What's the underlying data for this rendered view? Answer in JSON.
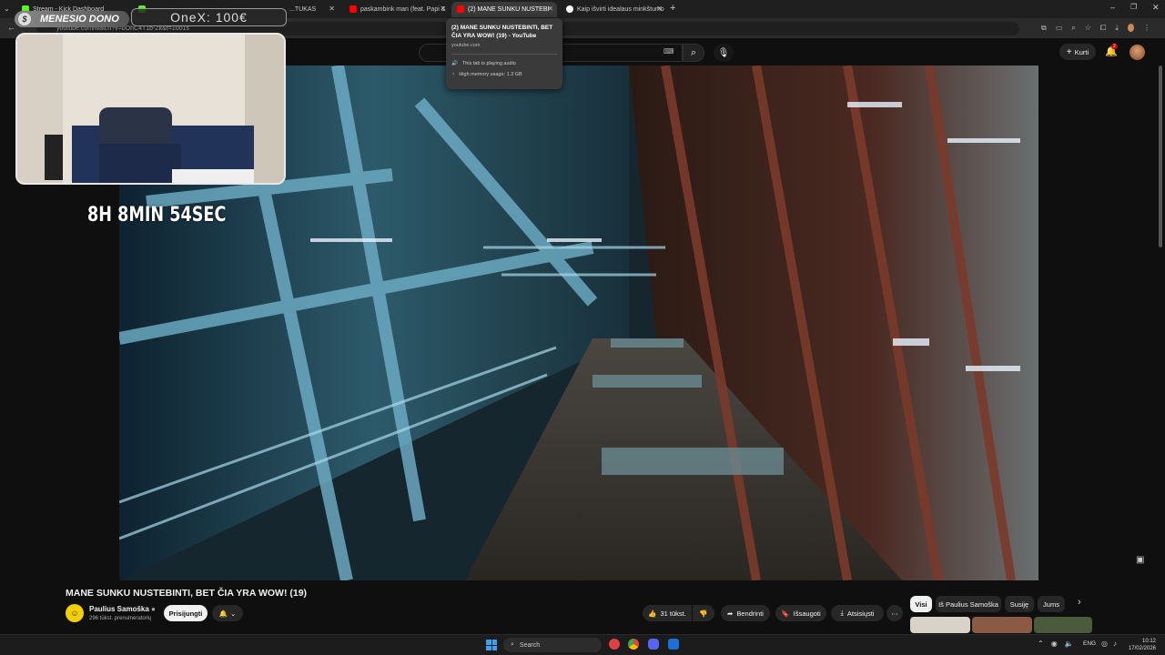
{
  "tabs": [
    {
      "label": "Stream - Kick Dashboard",
      "color": "#53fc18"
    },
    {
      "label": "K",
      "color": "#53fc18"
    },
    {
      "label": "...TUKAS",
      "color": "#888888"
    },
    {
      "label": "paskambink man (feat. Papi &",
      "color": "#ff0000"
    },
    {
      "label": "(2) MANE SUNKU NUSTEBI",
      "color": "#ff0000"
    },
    {
      "label": "Kaip išvirti idealaus minkštumo",
      "color": "#ffffff"
    }
  ],
  "address": {
    "url": "youtube.com/watch?v=bOhC4T1b-Zk&t=1001s"
  },
  "tooltip": {
    "title": "(2) MANE SUNKU NUSTEBINTI, BET ČIA YRA WOW! (19) - YouTube",
    "domain": "youtube.com",
    "audio": "This tab is playing audio",
    "memory": "High memory usage: 1.3 GB"
  },
  "overlay": {
    "dono_label": "MENESIO DONO",
    "onex": "OneX: 100€",
    "timer": "8H 8MIN 54SEC"
  },
  "masthead": {
    "create_label": "Kurti",
    "notif_count": "2"
  },
  "video": {
    "title": "MANE SUNKU NUSTEBINTI, BET ČIA YRA WOW! (19)",
    "channel": "Paulius Samoška",
    "subscribers": "296 tūkst. prenumeratorių",
    "subscribe_label": "Prisijungti",
    "likes": "31 tūkst.",
    "share_label": "Bendrinti",
    "save_label": "Išsaugoti",
    "download_label": "Atsisiųsti"
  },
  "chips": [
    "Visi",
    "Iš Paulius Samoška",
    "Susiję",
    "Jums"
  ],
  "taskbar": {
    "search_label": "Search",
    "lang": "ENG",
    "time": "10:12",
    "date": "17/02/2026"
  },
  "colors": {
    "accent": "#ff0000",
    "kick": "#53fc18",
    "bg": "#0f0f0f"
  }
}
